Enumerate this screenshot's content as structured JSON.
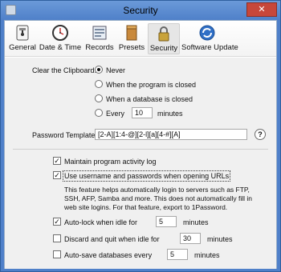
{
  "window": {
    "title": "Security",
    "close_glyph": "✕"
  },
  "toolbar": {
    "items": [
      {
        "label": "General",
        "icon": "general-icon"
      },
      {
        "label": "Date & Time",
        "icon": "clock-icon"
      },
      {
        "label": "Records",
        "icon": "records-icon"
      },
      {
        "label": "Presets",
        "icon": "presets-icon"
      },
      {
        "label": "Security",
        "icon": "lock-icon",
        "selected": true
      },
      {
        "label": "Software Update",
        "icon": "update-icon"
      }
    ]
  },
  "clipboard": {
    "label": "Clear the Clipboard:",
    "options": [
      {
        "label": "Never",
        "selected": true
      },
      {
        "label": "When the program is closed",
        "selected": false
      },
      {
        "label": "When a database is closed",
        "selected": false
      },
      {
        "label": "Every",
        "selected": false
      }
    ],
    "every_value": "10",
    "every_unit": "minutes"
  },
  "password_template": {
    "label": "Password Template:",
    "value": "[2-A][1:4-@][2-l][a][4-#][A]",
    "help": "?"
  },
  "options": {
    "maintain_log": {
      "label": "Maintain program activity log",
      "checked": true
    },
    "use_credentials": {
      "label": "Use username and passwords when opening URLs",
      "checked": true
    },
    "description": "This feature helps automatically login to servers such as FTP, SSH, AFP, Samba and more. This does not automatically fill in web site logins. For that feature, export to 1Password.",
    "autolock": {
      "label": "Auto-lock when idle for",
      "value": "5",
      "unit": "minutes",
      "checked": true
    },
    "discard": {
      "label": "Discard and quit when idle for",
      "value": "30",
      "unit": "minutes",
      "checked": false
    },
    "autosave": {
      "label": "Auto-save databases every",
      "value": "5",
      "unit": "minutes",
      "checked": false
    }
  },
  "colors": {
    "title_bar": "#4f80c9",
    "close_button": "#c7473a",
    "panel": "#f0f0f0"
  }
}
